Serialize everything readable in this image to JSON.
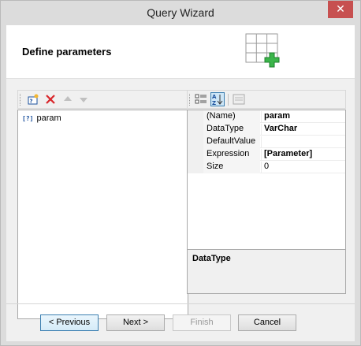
{
  "window": {
    "title": "Query Wizard",
    "close_glyph": "✕"
  },
  "header": {
    "title": "Define parameters",
    "icon": "table-add-icon"
  },
  "left_toolbar": {
    "icons": [
      "add-parameter-icon",
      "delete-icon",
      "move-up-icon",
      "move-down-icon"
    ]
  },
  "right_toolbar": {
    "icons": [
      "categorized-icon",
      "sort-alphabetical-icon",
      "property-pages-icon"
    ]
  },
  "param_list": {
    "items": [
      {
        "icon": "[?]",
        "label": "param"
      }
    ]
  },
  "properties": [
    {
      "name": "(Name)",
      "value": "param",
      "bold": true
    },
    {
      "name": "DataType",
      "value": "VarChar",
      "bold": true
    },
    {
      "name": "DefaultValue",
      "value": "",
      "bold": false
    },
    {
      "name": "Expression",
      "value": "[Parameter]",
      "bold": true
    },
    {
      "name": "Size",
      "value": "0",
      "bold": false
    }
  ],
  "description": {
    "title": "DataType"
  },
  "buttons": {
    "prev": "< Previous",
    "next": "Next >",
    "finish": "Finish",
    "cancel": "Cancel"
  },
  "colors": {
    "close": "#c75050",
    "accent_green": "#3bb54a",
    "delete_red": "#d9262b"
  }
}
